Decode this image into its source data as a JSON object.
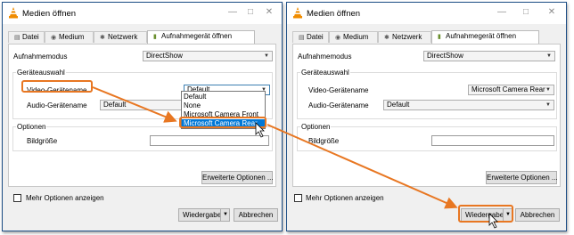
{
  "colors": {
    "accent": "#e87722",
    "window_border": "#1e4f86",
    "selection": "#0078d7"
  },
  "left_window": {
    "title": "Medien öffnen",
    "tabs": [
      {
        "icon": "file-icon",
        "label": "Datei"
      },
      {
        "icon": "disc-icon",
        "label": "Medium"
      },
      {
        "icon": "network-icon",
        "label": "Netzwerk"
      },
      {
        "icon": "capture-icon",
        "label": "Aufnahmegerät öffnen"
      }
    ],
    "aufnahmemodus_label": "Aufnahmemodus",
    "aufnahmemodus_value": "DirectShow",
    "geraeteauswahl_label": "Geräteauswahl",
    "video_label": "Video-Gerätename",
    "video_value": "Default",
    "audio_label": "Audio-Gerätename",
    "audio_value": "Default",
    "dropdown_options": [
      "Default",
      "None",
      "Microsoft Camera Front",
      "Microsoft Camera Rear"
    ],
    "optionen_label": "Optionen",
    "bildgroesse_label": "Bildgröße",
    "erweiterte_label": "Erweiterte Optionen ...",
    "mehr_optionen_label": "Mehr Optionen anzeigen",
    "wiedergabe_label": "Wiedergabe",
    "abbrechen_label": "Abbrechen"
  },
  "right_window": {
    "title": "Medien öffnen",
    "tabs": [
      {
        "icon": "file-icon",
        "label": "Datei"
      },
      {
        "icon": "disc-icon",
        "label": "Medium"
      },
      {
        "icon": "network-icon",
        "label": "Netzwerk"
      },
      {
        "icon": "capture-icon",
        "label": "Aufnahmegerät öffnen"
      }
    ],
    "aufnahmemodus_label": "Aufnahmemodus",
    "aufnahmemodus_value": "DirectShow",
    "geraeteauswahl_label": "Geräteauswahl",
    "video_label": "Video-Gerätename",
    "video_value": "Microsoft Camera Rear",
    "audio_label": "Audio-Gerätename",
    "audio_value": "Default",
    "optionen_label": "Optionen",
    "bildgroesse_label": "Bildgröße",
    "erweiterte_label": "Erweiterte Optionen ...",
    "mehr_optionen_label": "Mehr Optionen anzeigen",
    "wiedergabe_label": "Wiedergabe",
    "abbrechen_label": "Abbrechen"
  }
}
